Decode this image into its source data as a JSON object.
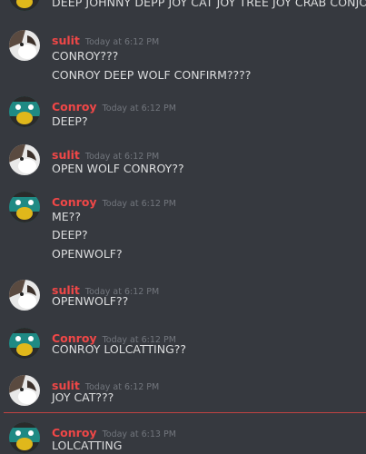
{
  "top_text": "DEEP JOHNNY DEPP JOY CAT JOY TREE JOY CRAB CONJOY",
  "messages": [
    {
      "author": "sulit",
      "avatar": "cat",
      "time": "Today at 6:12 PM",
      "lines": [
        "CONROY???",
        "CONROY DEEP WOLF CONFIRM????"
      ]
    },
    {
      "author": "Conroy",
      "avatar": "duck",
      "time": "Today at 6:12 PM",
      "lines": [
        "DEEP?"
      ]
    },
    {
      "author": "sulit",
      "avatar": "cat",
      "time": "Today at 6:12 PM",
      "lines": [
        "OPEN WOLF CONROY??"
      ]
    },
    {
      "author": "Conroy",
      "avatar": "duck",
      "time": "Today at 6:12 PM",
      "lines": [
        "ME??",
        "DEEP?",
        "OPENWOLF?"
      ]
    },
    {
      "author": "sulit",
      "avatar": "cat",
      "time": "Today at 6:12 PM",
      "lines": [
        "OPENWOLF??"
      ]
    },
    {
      "author": "Conroy",
      "avatar": "duck",
      "time": "Today at 6:12 PM",
      "lines": [
        "CONROY LOLCATTING??"
      ]
    },
    {
      "author": "sulit",
      "avatar": "cat",
      "time": "Today at 6:12 PM",
      "lines": [
        "JOY CAT???"
      ]
    },
    {
      "author": "Conroy",
      "avatar": "duck",
      "time": "Today at 6:13 PM",
      "lines": [
        "LOLCATTING"
      ]
    }
  ]
}
